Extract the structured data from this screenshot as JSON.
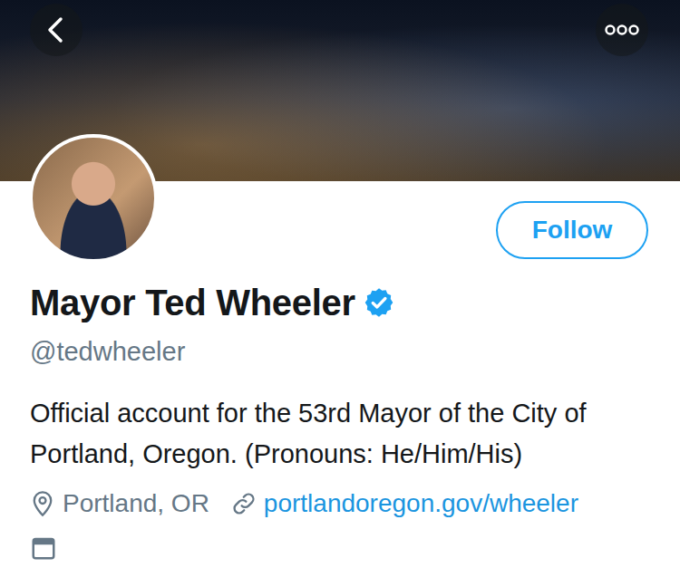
{
  "profile": {
    "name": "Mayor Ted Wheeler",
    "verified": true,
    "handle": "@tedwheeler",
    "bio": "Official account for the 53rd Mayor of the City of Portland, Oregon. (Pronouns: He/Him/His)",
    "location": "Portland, OR",
    "website": "portlandoregon.gov/wheeler"
  },
  "follow_button": {
    "label": "Follow",
    "following": false
  }
}
